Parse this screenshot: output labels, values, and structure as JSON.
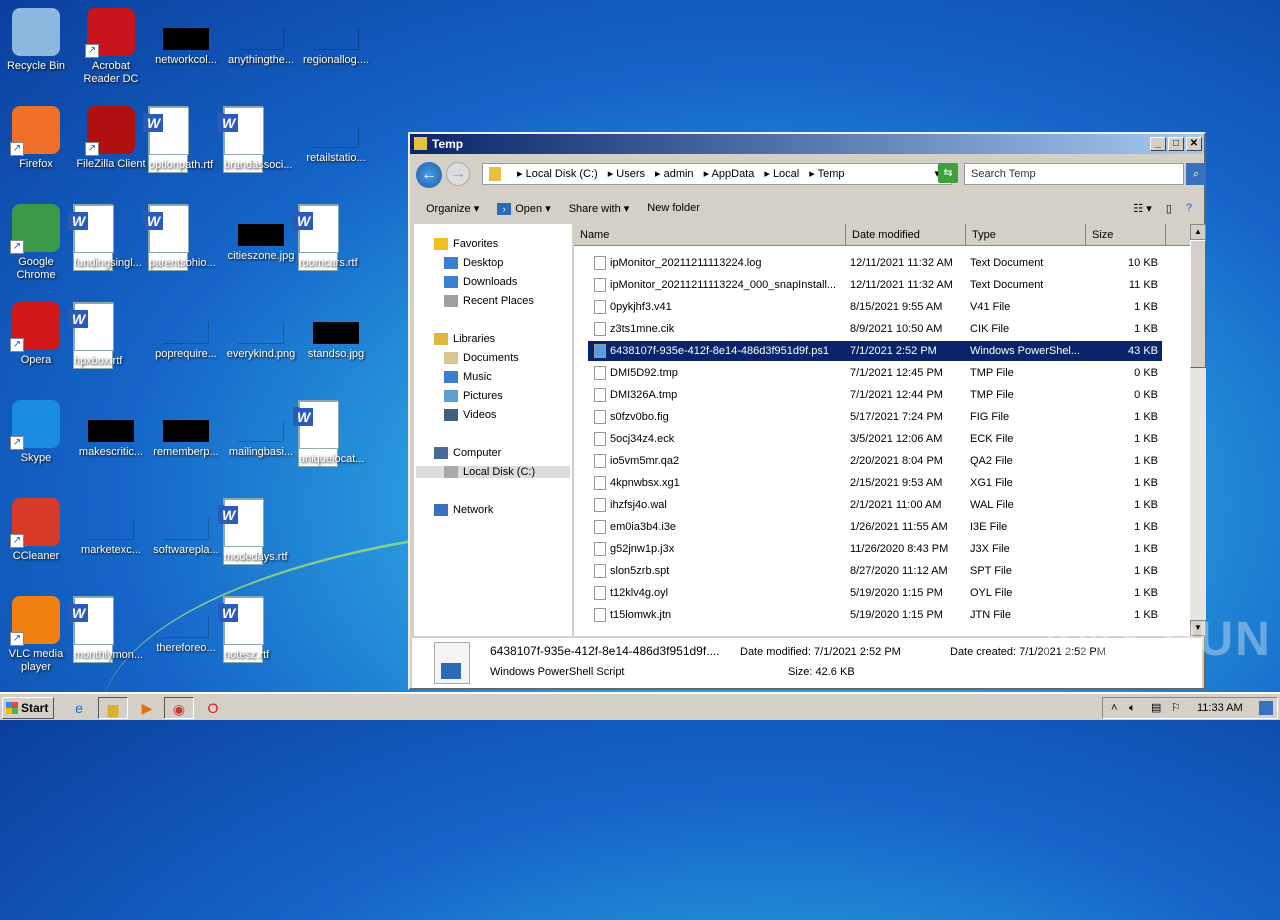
{
  "desktop": {
    "icons": [
      {
        "label": "Recycle Bin",
        "kind": "app",
        "color": "#8cb8e0",
        "col": 0,
        "row": 0
      },
      {
        "label": "Acrobat Reader DC",
        "kind": "app",
        "color": "#c8141c",
        "col": 1,
        "row": 0,
        "sc": true
      },
      {
        "label": "networkcol...",
        "kind": "black",
        "col": 2,
        "row": 0
      },
      {
        "label": "anythingthe...",
        "kind": "blank",
        "col": 3,
        "row": 0
      },
      {
        "label": "regionallog....",
        "kind": "blank",
        "col": 4,
        "row": 0
      },
      {
        "label": "Firefox",
        "kind": "app",
        "color": "#f0702a",
        "col": 0,
        "row": 1,
        "sc": true
      },
      {
        "label": "FileZilla Client",
        "kind": "app",
        "color": "#b01010",
        "col": 1,
        "row": 1,
        "sc": true
      },
      {
        "label": "optionpath.rtf",
        "kind": "word",
        "col": 2,
        "row": 1
      },
      {
        "label": "brandassoci...",
        "kind": "word",
        "col": 3,
        "row": 1
      },
      {
        "label": "retailstatio...",
        "kind": "blank",
        "col": 4,
        "row": 1
      },
      {
        "label": "Google Chrome",
        "kind": "app",
        "color": "#3a9a4a",
        "col": 0,
        "row": 2,
        "sc": true
      },
      {
        "label": "fundingsingl...",
        "kind": "word",
        "col": 1,
        "row": 2
      },
      {
        "label": "parentsohio...",
        "kind": "word",
        "col": 2,
        "row": 2
      },
      {
        "label": "citieszone.jpg",
        "kind": "black",
        "col": 3,
        "row": 2
      },
      {
        "label": "roomcars.rtf",
        "kind": "word",
        "col": 4,
        "row": 2
      },
      {
        "label": "Opera",
        "kind": "app",
        "color": "#d01818",
        "col": 0,
        "row": 3,
        "sc": true
      },
      {
        "label": "hpxbox.rtf",
        "kind": "word",
        "col": 1,
        "row": 3
      },
      {
        "label": "poprequire...",
        "kind": "blank",
        "col": 2,
        "row": 3
      },
      {
        "label": "everykind.png",
        "kind": "blank",
        "col": 3,
        "row": 3
      },
      {
        "label": "standso.jpg",
        "kind": "black",
        "col": 4,
        "row": 3
      },
      {
        "label": "Skype",
        "kind": "app",
        "color": "#1a8ce0",
        "col": 0,
        "row": 4,
        "sc": true
      },
      {
        "label": "makescritic...",
        "kind": "black",
        "col": 1,
        "row": 4
      },
      {
        "label": "rememberp...",
        "kind": "black",
        "col": 2,
        "row": 4
      },
      {
        "label": "mailingbasi...",
        "kind": "blank",
        "col": 3,
        "row": 4
      },
      {
        "label": "uniquelocat...",
        "kind": "word",
        "col": 4,
        "row": 4
      },
      {
        "label": "CCleaner",
        "kind": "app",
        "color": "#d83a2a",
        "col": 0,
        "row": 5,
        "sc": true
      },
      {
        "label": "marketexc...",
        "kind": "blank",
        "col": 1,
        "row": 5
      },
      {
        "label": "softwarepla...",
        "kind": "blank",
        "col": 2,
        "row": 5
      },
      {
        "label": "modedays.rtf",
        "kind": "word",
        "col": 3,
        "row": 5
      },
      {
        "label": "VLC media player",
        "kind": "app",
        "color": "#f08010",
        "col": 0,
        "row": 6,
        "sc": true
      },
      {
        "label": "monthlymon...",
        "kind": "word",
        "col": 1,
        "row": 6
      },
      {
        "label": "thereforeo...",
        "kind": "blank",
        "col": 2,
        "row": 6
      },
      {
        "label": "notesz.rtf",
        "kind": "word",
        "col": 3,
        "row": 6
      }
    ]
  },
  "explorer": {
    "title": "Temp",
    "breadcrumb": [
      "Local Disk (C:)",
      "Users",
      "admin",
      "AppData",
      "Local",
      "Temp"
    ],
    "search_placeholder": "Search Temp",
    "toolbar": {
      "organize": "Organize ▾",
      "open": "Open",
      "share": "Share with ▾",
      "new_folder": "New folder"
    },
    "nav": [
      {
        "label": "Favorites",
        "sub": false
      },
      {
        "label": "Desktop",
        "sub": true
      },
      {
        "label": "Downloads",
        "sub": true
      },
      {
        "label": "Recent Places",
        "sub": true
      },
      {
        "label": "Libraries",
        "sub": false
      },
      {
        "label": "Documents",
        "sub": true
      },
      {
        "label": "Music",
        "sub": true
      },
      {
        "label": "Pictures",
        "sub": true
      },
      {
        "label": "Videos",
        "sub": true
      },
      {
        "label": "Computer",
        "sub": false
      },
      {
        "label": "Local Disk (C:)",
        "sub": true,
        "selected": true
      },
      {
        "label": "Network",
        "sub": false
      }
    ],
    "columns": [
      "Name",
      "Date modified",
      "Type",
      "Size"
    ],
    "files": [
      [
        "ipMonitor_20211211113224.log",
        "12/11/2021 11:32 AM",
        "Text Document",
        "10 KB"
      ],
      [
        "ipMonitor_20211211113224_000_snapInstall...",
        "12/11/2021 11:32 AM",
        "Text Document",
        "11 KB"
      ],
      [
        "0pykjhf3.v41",
        "8/15/2021 9:55 AM",
        "V41 File",
        "1 KB"
      ],
      [
        "z3ts1mne.cik",
        "8/9/2021 10:50 AM",
        "CIK File",
        "1 KB"
      ],
      [
        "6438107f-935e-412f-8e14-486d3f951d9f.ps1",
        "7/1/2021 2:52 PM",
        "Windows PowerShel...",
        "43 KB"
      ],
      [
        "DMI5D92.tmp",
        "7/1/2021 12:45 PM",
        "TMP File",
        "0 KB"
      ],
      [
        "DMI326A.tmp",
        "7/1/2021 12:44 PM",
        "TMP File",
        "0 KB"
      ],
      [
        "s0fzv0bo.fig",
        "5/17/2021 7:24 PM",
        "FIG File",
        "1 KB"
      ],
      [
        "5ocj34z4.eck",
        "3/5/2021 12:06 AM",
        "ECK File",
        "1 KB"
      ],
      [
        "io5vm5mr.qa2",
        "2/20/2021 8:04 PM",
        "QA2 File",
        "1 KB"
      ],
      [
        "4kpnwbsx.xg1",
        "2/15/2021 9:53 AM",
        "XG1 File",
        "1 KB"
      ],
      [
        "ihzfsj4o.wal",
        "2/1/2021 11:00 AM",
        "WAL File",
        "1 KB"
      ],
      [
        "em0ia3b4.i3e",
        "1/26/2021 11:55 AM",
        "I3E File",
        "1 KB"
      ],
      [
        "g52jnw1p.j3x",
        "11/26/2020 8:43 PM",
        "J3X File",
        "1 KB"
      ],
      [
        "slon5zrb.spt",
        "8/27/2020 11:12 AM",
        "SPT File",
        "1 KB"
      ],
      [
        "t12klv4g.oyl",
        "5/19/2020 1:15 PM",
        "OYL File",
        "1 KB"
      ],
      [
        "t15lomwk.jtn",
        "5/19/2020 1:15 PM",
        "JTN File",
        "1 KB"
      ]
    ],
    "selected_index": 4,
    "details": {
      "name": "6438107f-935e-412f-8e14-486d3f951d9f....",
      "type": "Windows PowerShell Script",
      "modified": "Date modified: 7/1/2021 2:52 PM",
      "size": "Size: 42.6 KB",
      "created": "Date created: 7/1/2021 2:52 PM"
    }
  },
  "watermark": "ANY RUN",
  "taskbar": {
    "start": "Start",
    "clock": "11:33 AM"
  }
}
